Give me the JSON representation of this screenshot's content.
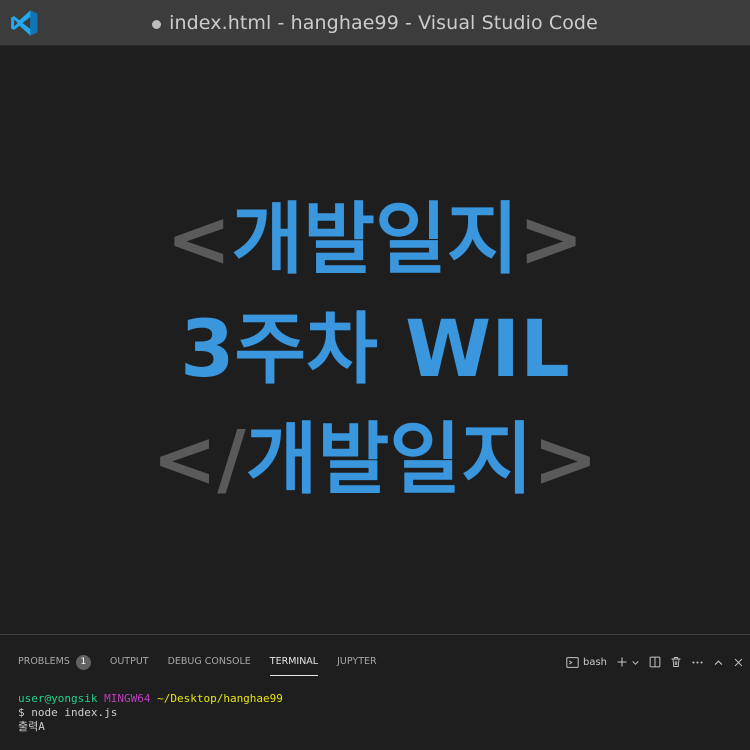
{
  "window": {
    "title": "index.html - hanghae99 - Visual Studio Code",
    "dirty": true
  },
  "editor": {
    "line1": {
      "open": "<",
      "text": "개발일지",
      "close": ">"
    },
    "line2": {
      "text": "3주차 WIL"
    },
    "line3": {
      "open": "</",
      "text": "개발일지",
      "close": ">"
    }
  },
  "panel": {
    "tabs": [
      {
        "label": "PROBLEMS",
        "badge": "1"
      },
      {
        "label": "OUTPUT"
      },
      {
        "label": "DEBUG CONSOLE"
      },
      {
        "label": "TERMINAL",
        "active": true
      },
      {
        "label": "JUPYTER"
      }
    ],
    "actions": {
      "shell_label": "bash"
    }
  },
  "terminal": {
    "prompt_user": "user@yongsik",
    "prompt_host": "MINGW64",
    "prompt_path": "~/Desktop/hanghae99",
    "command": "$ node index.js",
    "output": "출력A"
  },
  "colors": {
    "accent": "#3a96dd",
    "bracket": "#5a5a5a",
    "vscode_blue": "#23a9f2",
    "terminal_green": "#23d18b",
    "terminal_magenta": "#bc3fbc",
    "terminal_yellow": "#e5e510"
  },
  "icons": {
    "app": "vscode-logo-icon",
    "terminal_shell": "terminal-icon",
    "new_terminal": "plus-icon",
    "dropdown": "chevron-down-icon",
    "split": "split-icon",
    "delete": "trash-icon",
    "more": "ellipsis-icon",
    "maximize": "chevron-up-icon",
    "close": "close-icon"
  }
}
